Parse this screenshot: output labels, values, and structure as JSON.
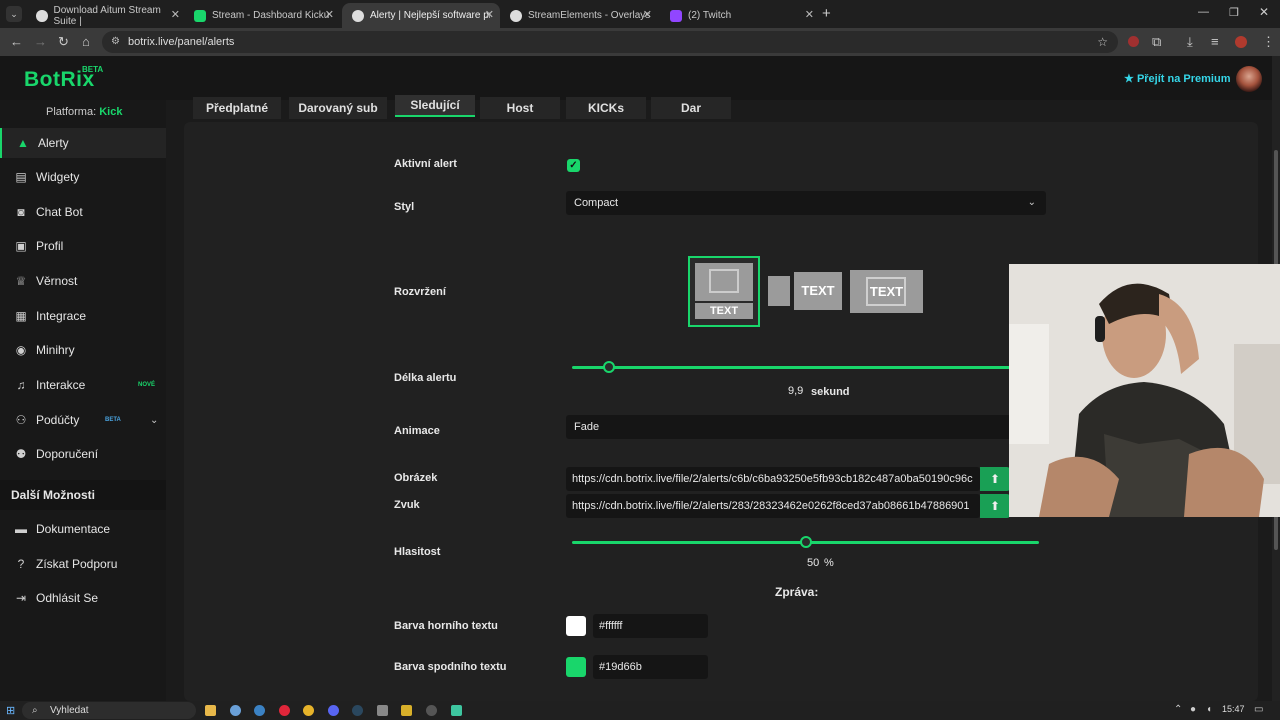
{
  "browser": {
    "tabs": [
      {
        "title": "Download Aitum Stream Suite |",
        "favicon_color": "#dddddd"
      },
      {
        "title": "Stream - Dashboard Kicku",
        "favicon_color": "#19d66b"
      },
      {
        "title": "Alerty | Nejlepší software pro v",
        "favicon_color": "#dddddd"
      },
      {
        "title": "StreamElements - Overlays",
        "favicon_color": "#dddddd"
      },
      {
        "title": "(2) Twitch",
        "favicon_color": "#9146ff"
      }
    ],
    "url": "botrix.live/panel/alerts"
  },
  "header": {
    "logo": "BotRix",
    "beta": "BETA",
    "premium": "Přejít na Premium"
  },
  "sidebar": {
    "platform_label": "Platforma:",
    "platform_value": "Kick",
    "items": [
      {
        "label": "Alerty",
        "icon": "warning-icon"
      },
      {
        "label": "Widgety",
        "icon": "widgets-icon"
      },
      {
        "label": "Chat Bot",
        "icon": "robot-icon"
      },
      {
        "label": "Profil",
        "icon": "profile-icon"
      },
      {
        "label": "Věrnost",
        "icon": "trophy-icon"
      },
      {
        "label": "Integrace",
        "icon": "integration-icon"
      },
      {
        "label": "Minihry",
        "icon": "gamepad-icon"
      },
      {
        "label": "Interakce",
        "icon": "music-icon",
        "badge": "NOVÉ"
      },
      {
        "label": "Podúčty",
        "icon": "users-icon",
        "badge": "BETA"
      },
      {
        "label": "Doporučení",
        "icon": "referral-icon"
      }
    ],
    "more_heading": "Další Možnosti",
    "more_items": [
      {
        "label": "Dokumentace",
        "icon": "docs-icon"
      },
      {
        "label": "Získat Podporu",
        "icon": "help-icon"
      },
      {
        "label": "Odhlásit Se",
        "icon": "logout-icon"
      }
    ]
  },
  "tabs": [
    "Předplatné",
    "Darovaný sub",
    "Sledující",
    "Host",
    "KICKs",
    "Dar"
  ],
  "form": {
    "active_label": "Aktivní alert",
    "style_label": "Styl",
    "style_value": "Compact",
    "layout_label": "Rozvržení",
    "layout_text": "TEXT",
    "duration_label": "Délka alertu",
    "duration_value": "9,9",
    "duration_unit": "sekund",
    "duration_fraction": 0.08,
    "animation_label": "Animace",
    "animation_value": "Fade",
    "image_label": "Obrázek",
    "image_url": "https://cdn.botrix.live/file/2/alerts/c6b/c6ba93250e5fb93cb182c487a0ba50190c96c",
    "sound_label": "Zvuk",
    "sound_url": "https://cdn.botrix.live/file/2/alerts/283/28323462e0262f8ced37ab08661b47886901",
    "volume_label": "Hlasitost",
    "volume_value": "50",
    "volume_unit": "%",
    "volume_fraction": 0.5,
    "message_heading": "Zpráva:",
    "top_color_label": "Barva horního textu",
    "top_color": "#ffffff",
    "bottom_color_label": "Barva spodního textu",
    "bottom_color": "#19d66b"
  },
  "taskbar": {
    "search": "Vyhledat",
    "time": "15:47"
  },
  "colors": {
    "accent": "#19d66b",
    "premium": "#35d6e8"
  }
}
